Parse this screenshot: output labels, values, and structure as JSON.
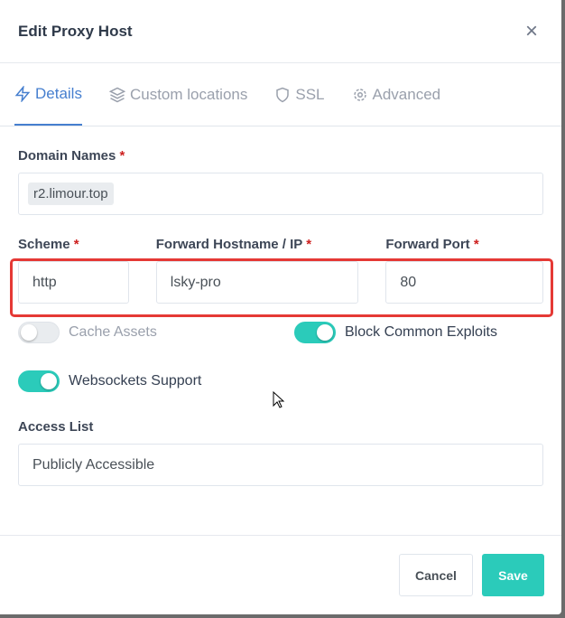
{
  "header": {
    "title": "Edit Proxy Host",
    "close": "×"
  },
  "tabs": [
    {
      "label": "Details",
      "icon": "lightning-icon"
    },
    {
      "label": "Custom locations",
      "icon": "layers-icon"
    },
    {
      "label": "SSL",
      "icon": "shield-icon"
    },
    {
      "label": "Advanced",
      "icon": "gear-icon"
    }
  ],
  "form": {
    "domain_label": "Domain Names",
    "required": "*",
    "domain": "r2.limour.top",
    "scheme_label": "Scheme",
    "scheme": "http",
    "host_label": "Forward Hostname / IP",
    "host": "lsky-pro",
    "port_label": "Forward Port",
    "port": "80",
    "cache_label": "Cache Assets",
    "cache": false,
    "block_label": "Block Common Exploits",
    "block": true,
    "ws_label": "Websockets Support",
    "ws": true,
    "access_label": "Access List",
    "access": "Publicly Accessible"
  },
  "footer": {
    "cancel": "Cancel",
    "save": "Save"
  },
  "colors": {
    "accent": "#467fcf",
    "toggle_on": "#2bcbba",
    "highlight": "#e53935"
  }
}
